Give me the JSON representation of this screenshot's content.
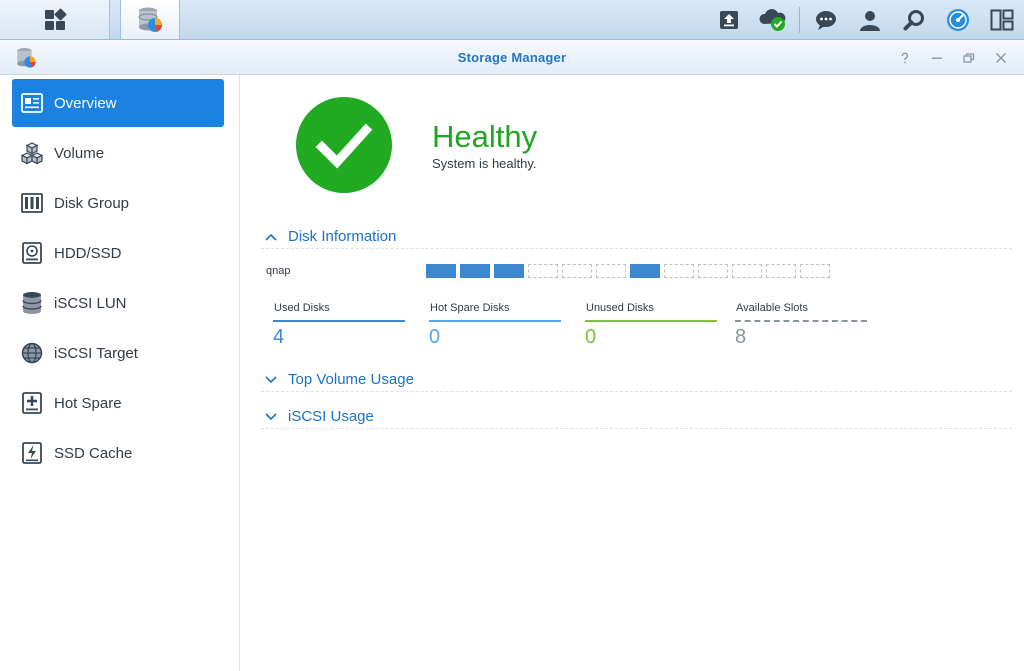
{
  "window": {
    "title": "Storage Manager"
  },
  "sidebar": {
    "items": [
      {
        "label": "Overview",
        "icon": "overview-icon",
        "active": true
      },
      {
        "label": "Volume",
        "icon": "volume-icon"
      },
      {
        "label": "Disk Group",
        "icon": "disk-group-icon"
      },
      {
        "label": "HDD/SSD",
        "icon": "hdd-icon"
      },
      {
        "label": "iSCSI LUN",
        "icon": "iscsi-lun-icon"
      },
      {
        "label": "iSCSI Target",
        "icon": "iscsi-target-icon"
      },
      {
        "label": "Hot Spare",
        "icon": "hot-spare-icon"
      },
      {
        "label": "SSD Cache",
        "icon": "ssd-cache-icon"
      }
    ]
  },
  "status": {
    "title": "Healthy",
    "subtitle": "System is healthy.",
    "color": "#22ab22"
  },
  "disk_info": {
    "title": "Disk Information",
    "pool_name": "qnap",
    "slots": [
      "used",
      "used",
      "used",
      "empty",
      "empty",
      "empty",
      "used",
      "empty",
      "empty",
      "empty",
      "empty",
      "empty"
    ],
    "stats": [
      {
        "label": "Used Disks",
        "value": "4",
        "color": "#3d87cf"
      },
      {
        "label": "Hot Spare Disks",
        "value": "0",
        "color": "#56a6e8"
      },
      {
        "label": "Unused Disks",
        "value": "0",
        "color": "#7fc33a"
      },
      {
        "label": "Available Slots",
        "value": "8",
        "color": "#8a949e"
      }
    ]
  },
  "sections": {
    "top_volume": "Top Volume Usage",
    "iscsi": "iSCSI Usage"
  },
  "colors": {
    "accent": "#1b82e0",
    "link": "#1a73c7"
  }
}
